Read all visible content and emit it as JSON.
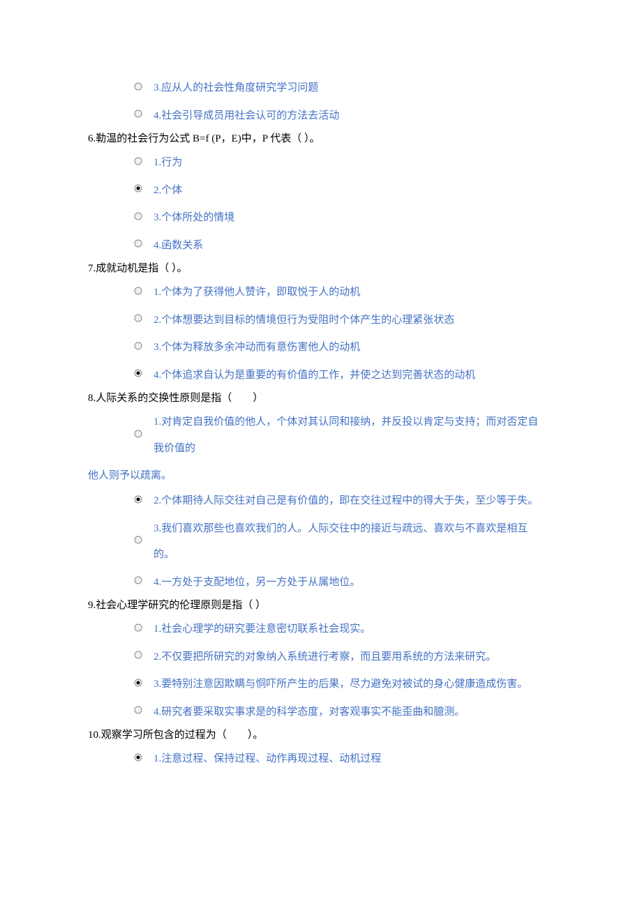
{
  "colors": {
    "option_text": "#4472c4",
    "question_text": "#000000"
  },
  "icons": {
    "radio_unchecked": "radio-unchecked-icon",
    "radio_checked": "radio-checked-icon"
  },
  "orphan_options": [
    {
      "label": "3.应从人的社会性角度研究学习问题",
      "checked": false
    },
    {
      "label": "4.社会引导成员用社会认可的方法去活动",
      "checked": false
    }
  ],
  "questions": [
    {
      "number": "6",
      "stem": "6.勒温的社会行为公式 B=f (P，E)中，P 代表（ ）。",
      "options": [
        {
          "label": "1.行为",
          "checked": false
        },
        {
          "label": "2.个体",
          "checked": true
        },
        {
          "label": "3.个体所处的情境",
          "checked": false
        },
        {
          "label": "4.函数关系",
          "checked": false
        }
      ]
    },
    {
      "number": "7",
      "stem": "7.成就动机是指（ ）。",
      "options": [
        {
          "label": "1.个体为了获得他人赞许，即取悦于人的动机",
          "checked": false
        },
        {
          "label": "2.个体想要达到目标的情境但行为受阻时个体产生的心理紧张状态",
          "checked": false
        },
        {
          "label": "3.个体为释放多余冲动而有意伤害他人的动机",
          "checked": false
        },
        {
          "label": "4.个体追求自认为是重要的有价值的工作，并使之达到完善状态的动机",
          "checked": true
        }
      ]
    },
    {
      "number": "8",
      "stem": "8.人际关系的交换性原则是指（　　）",
      "options": [
        {
          "label": "1.对肯定自我价值的他人，个体对其认同和接纳，并反投以肯定与支持；而对否定自我价值的",
          "checked": false,
          "wrap": "他人则予以疏离。"
        },
        {
          "label": "2.个体期待人际交往对自己是有价值的，即在交往过程中的得大于失，至少等于失。",
          "checked": true
        },
        {
          "label": "3.我们喜欢那些也喜欢我们的人。人际交往中的接近与疏远、喜欢与不喜欢是相互的。",
          "checked": false
        },
        {
          "label": "4.一方处于支配地位，另一方处于从属地位。",
          "checked": false
        }
      ]
    },
    {
      "number": "9",
      "stem": "9.社会心理学研究的伦理原则是指（ ）",
      "options": [
        {
          "label": "1.社会心理学的研究要注意密切联系社会现实。",
          "checked": false
        },
        {
          "label": "2.不仅要把所研究的对象纳入系统进行考察，而且要用系统的方法来研究。",
          "checked": false
        },
        {
          "label": "3.要特别注意因欺瞒与恫吓所产生的后果，尽力避免对被试的身心健康造成伤害。",
          "checked": true
        },
        {
          "label": "4.研究者要采取实事求是的科学态度，对客观事实不能歪曲和臆测。",
          "checked": false
        }
      ]
    },
    {
      "number": "10",
      "stem": "10.观察学习所包含的过程为（　　）。",
      "options": [
        {
          "label": "1.注意过程、保持过程、动作再现过程、动机过程",
          "checked": true
        }
      ]
    }
  ]
}
